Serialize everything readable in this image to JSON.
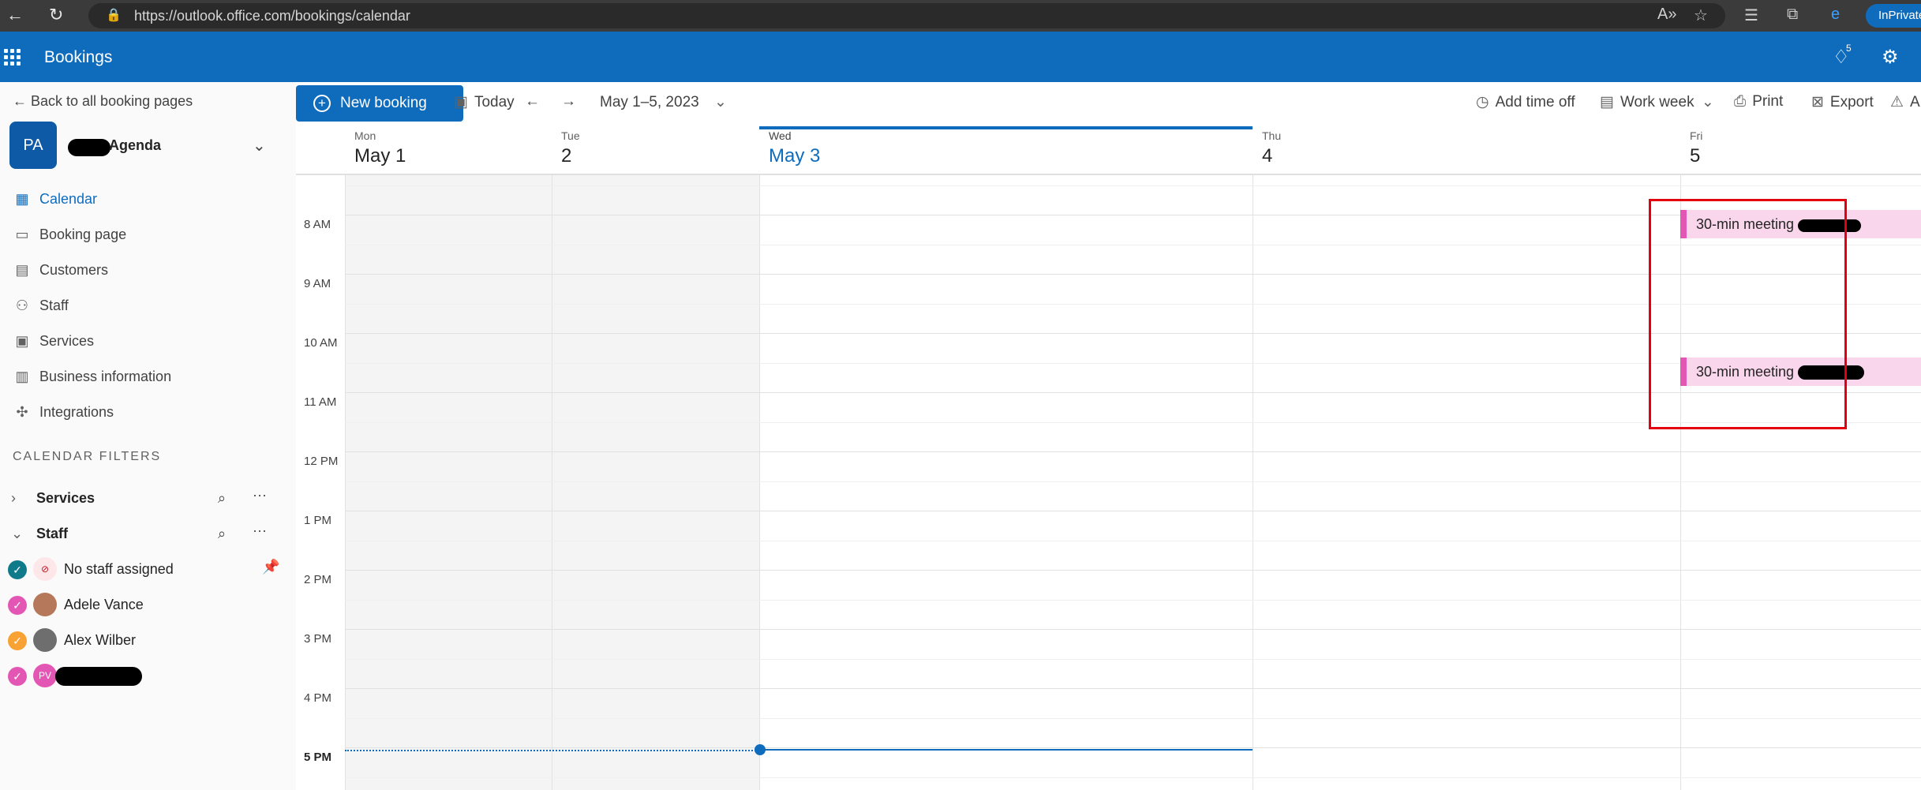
{
  "browser": {
    "url": "https://outlook.office.com/bookings/calendar",
    "inprivate_label": "InPrivate"
  },
  "header": {
    "app_title": "Bookings",
    "notification_count": "5"
  },
  "sidebar": {
    "back_link": "Back to all booking pages",
    "avatar_initials": "PA",
    "business_name": "Agenda",
    "items": [
      {
        "label": "Calendar",
        "icon": "calendar-icon",
        "active": true
      },
      {
        "label": "Booking page",
        "icon": "monitor-icon"
      },
      {
        "label": "Customers",
        "icon": "contact-card-icon"
      },
      {
        "label": "Staff",
        "icon": "people-icon"
      },
      {
        "label": "Services",
        "icon": "briefcase-icon"
      },
      {
        "label": "Business information",
        "icon": "building-icon"
      },
      {
        "label": "Integrations",
        "icon": "integrations-icon"
      }
    ],
    "filters_title": "CALENDAR FILTERS",
    "filters": [
      {
        "label": "Services",
        "expanded": false
      },
      {
        "label": "Staff",
        "expanded": true
      }
    ],
    "staff": [
      {
        "name": "No staff assigned",
        "color": "#0f6cbd",
        "pinned": true
      },
      {
        "name": "Adele Vance",
        "color": "#e356b4"
      },
      {
        "name": "Alex Wilber",
        "color": "#f7a233"
      },
      {
        "name": "",
        "initials": "PV",
        "color": "#e356b4"
      }
    ]
  },
  "toolbar": {
    "new_booking": "New booking",
    "today": "Today",
    "date_range": "May 1–5, 2023",
    "add_time_off": "Add time off",
    "view": "Work week",
    "print": "Print",
    "export": "Export",
    "more": "A"
  },
  "calendar": {
    "days": [
      {
        "dow": "Mon",
        "date": "May 1",
        "past": true
      },
      {
        "dow": "Tue",
        "date": "2",
        "past": true
      },
      {
        "dow": "Wed",
        "date": "May 3",
        "today": true
      },
      {
        "dow": "Thu",
        "date": "4"
      },
      {
        "dow": "Fri",
        "date": "5"
      }
    ],
    "hours": [
      "8 AM",
      "9 AM",
      "10 AM",
      "11 AM",
      "12 PM",
      "1 PM",
      "2 PM",
      "3 PM",
      "4 PM",
      "5 PM"
    ],
    "current_hour": "5 PM",
    "events": [
      {
        "title": "30-min meeting",
        "day": "Fri",
        "start": "8:00 AM",
        "end": "8:30 AM",
        "color": "#e356b4"
      },
      {
        "title": "30-min meeting",
        "day": "Fri",
        "start": "10:30 AM",
        "end": "11:00 AM",
        "color": "#e356b4"
      }
    ]
  },
  "colors": {
    "brand": "#0f6cbd",
    "event_fill": "#f9d6ec",
    "event_accent": "#e356b4",
    "highlight": "#e3000f"
  }
}
